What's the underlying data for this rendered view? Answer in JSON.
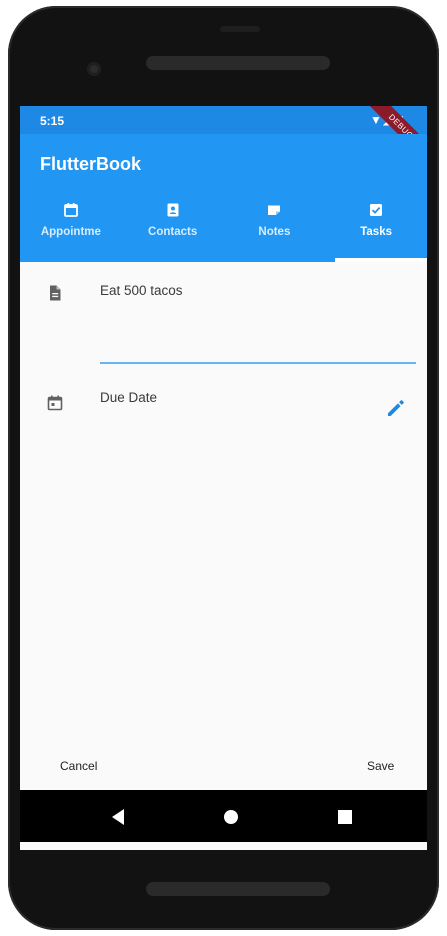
{
  "status_bar": {
    "time": "5:15",
    "icons": "▼◢ ▮",
    "debug_banner": "DEBUG"
  },
  "app_bar": {
    "title": "FlutterBook",
    "tabs": [
      {
        "label": "Appointme",
        "icon": "calendar-icon",
        "active": false
      },
      {
        "label": "Contacts",
        "icon": "contact-card-icon",
        "active": false
      },
      {
        "label": "Notes",
        "icon": "note-icon",
        "active": false
      },
      {
        "label": "Tasks",
        "icon": "check-box-icon",
        "active": true
      }
    ]
  },
  "task_form": {
    "description_value": "Eat 500 tacos",
    "description_icon": "description-icon",
    "due_date_label": "Due Date",
    "due_date_icon": "event-icon",
    "edit_icon": "edit-pencil-icon"
  },
  "actions": {
    "cancel_label": "Cancel",
    "save_label": "Save"
  },
  "system_nav": {
    "back_icon": "back-triangle-icon",
    "home_icon": "home-circle-icon",
    "recents_icon": "recents-square-icon"
  },
  "colors": {
    "primary": "#2196f3",
    "status_bar": "#1e88e5",
    "accent": "#1e88e5",
    "underline": "#64b5f6",
    "debug_ribbon": "#8b1a2b"
  }
}
